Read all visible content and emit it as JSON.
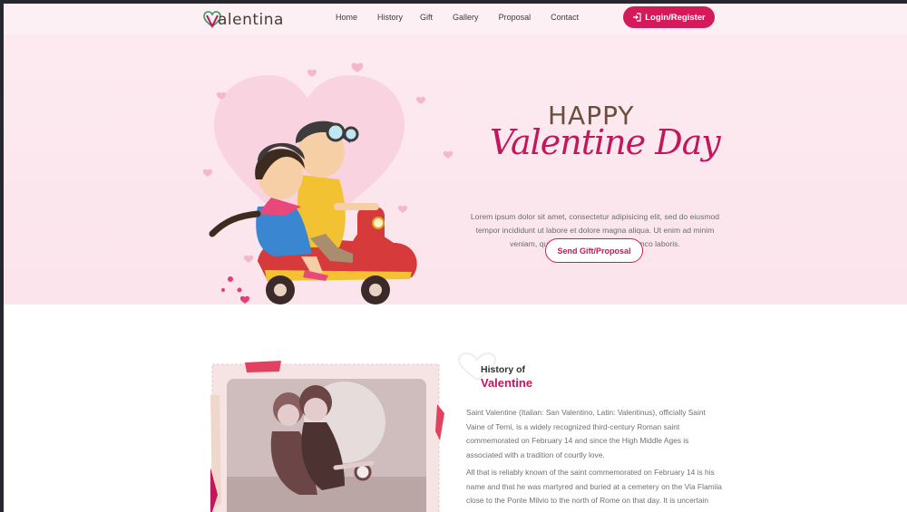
{
  "brand": {
    "logo_text": "alentina"
  },
  "nav": {
    "items": [
      "Home",
      "History",
      "Gift",
      "Gallery",
      "Proposal",
      "Contact"
    ],
    "login_label": "Login/Register"
  },
  "hero": {
    "title_top": "HAPPY",
    "title_script": "Valentine Day",
    "description": "Lorem ipsum dolor sit amet, consectetur adipisicing elit, sed do eiusmod tempor incididunt ut labore et dolore magna aliqua. Ut enim ad minim veniam, quis nostrud exercitation ullamco laboris.",
    "cta_label": "Send Gift/Proposal"
  },
  "history": {
    "kicker": "History of",
    "title": "Valentine",
    "paragraph_1": "Saint Valentine (Italian: San Valentino, Latin: Valentinus), officially Saint Vaine of Terni, is a widely recognized third-century Roman saint commemorated on February 14 and since the High Middle Ages is associated with a tradition of courtly love.",
    "paragraph_2": "All that is reliably known of the saint commemorated on February 14 is his name and that he was martyred and buried at a cemetery on the Via Flamiia close to the Ponte Milvio to the north of Rome on that day. It is uncertain whether St. Valentine is to be identified as one saint or the conflation of two"
  },
  "colors": {
    "accent": "#d41a5b",
    "script": "#c2185b",
    "hero_bg": "#fdeaf0",
    "title_brown": "#6b4f3a"
  },
  "icons": {
    "logo": "heart-v-icon",
    "login": "sign-in-icon",
    "section": "heart-outline-icon"
  }
}
